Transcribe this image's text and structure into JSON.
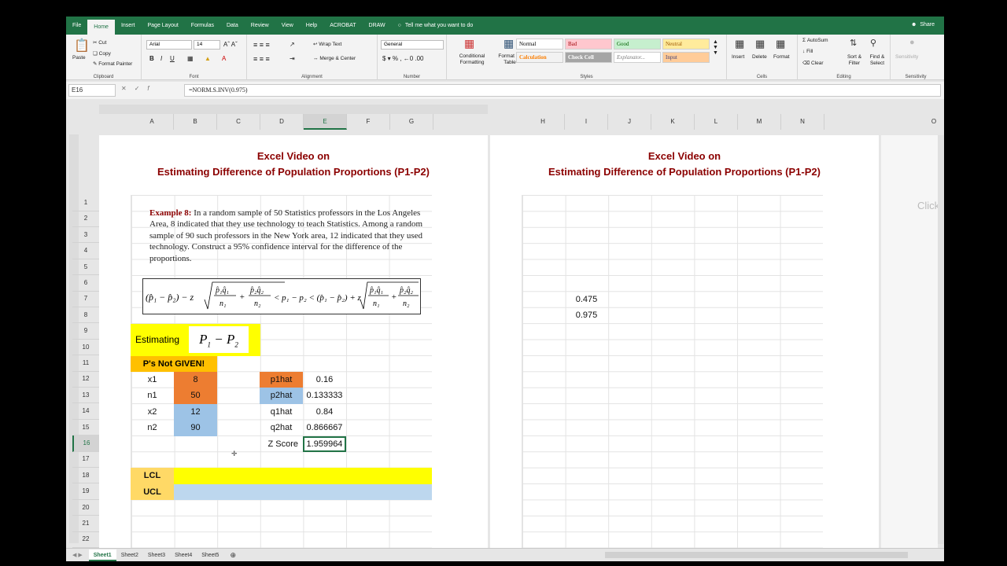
{
  "tabs": [
    "File",
    "Home",
    "Insert",
    "Page Layout",
    "Formulas",
    "Data",
    "Review",
    "View",
    "Help",
    "ACROBAT",
    "DRAW"
  ],
  "active_tab": "Home",
  "tell_me": "Tell me what you want to do",
  "share": "Share",
  "clipboard": {
    "paste": "Paste",
    "cut": "Cut",
    "copy": "Copy",
    "format_painter": "Format Painter",
    "label": "Clipboard"
  },
  "font": {
    "name": "Arial",
    "size": "14",
    "label": "Font"
  },
  "alignment": {
    "wrap": "Wrap Text",
    "merge": "Merge & Center",
    "label": "Alignment"
  },
  "number": {
    "format": "General",
    "label": "Number"
  },
  "styles": {
    "cond": "Conditional Formatting",
    "table": "Format as Table",
    "normal": "Normal",
    "bad": "Bad",
    "good": "Good",
    "neutral": "Neutral",
    "calculation": "Calculation",
    "check": "Check Cell",
    "explanatory": "Explanator...",
    "input": "Input",
    "label": "Styles"
  },
  "cells": {
    "insert": "Insert",
    "delete": "Delete",
    "format": "Format",
    "label": "Cells"
  },
  "editing": {
    "autosum": "AutoSum",
    "fill": "Fill",
    "clear": "Clear",
    "sort": "Sort & Filter",
    "find": "Find & Select",
    "label": "Editing"
  },
  "sensitivity": {
    "btn": "Sensitivity",
    "label": "Sensitivity"
  },
  "namebox": "E16",
  "formula": "=NORM.S.INV(0.975)",
  "columns": [
    "A",
    "B",
    "C",
    "D",
    "E",
    "F",
    "G",
    "H",
    "I",
    "J",
    "K",
    "L",
    "M",
    "N",
    "O"
  ],
  "rows": [
    "1",
    "2",
    "3",
    "4",
    "5",
    "6",
    "7",
    "8",
    "9",
    "10",
    "11",
    "12",
    "13",
    "14",
    "15",
    "16",
    "17",
    "18",
    "19",
    "20",
    "21",
    "22"
  ],
  "title1": "Excel Video on",
  "title2": "Estimating Difference of Population Proportions (P1-P2)",
  "example_label": "Example 8:",
  "example_text": "In a random sample of 50 Statistics professors in the Los Angeles Area, 8 indicated that they use technology to teach Statistics. Among a random sample of 90 such professors in the New York area, 12 indicated that they used technology. Construct a 95% confidence interval for the difference of the proportions.",
  "estimating": "Estimating",
  "p_not_given": "P's Not GIVEN!",
  "inputs": [
    {
      "label": "x1",
      "value": "8"
    },
    {
      "label": "n1",
      "value": "50"
    },
    {
      "label": "x2",
      "value": "12"
    },
    {
      "label": "n2",
      "value": "90"
    }
  ],
  "calc": [
    {
      "label": "p1hat",
      "value": "0.16"
    },
    {
      "label": "p2hat",
      "value": "0.133333"
    },
    {
      "label": "q1hat",
      "value": "0.84"
    },
    {
      "label": "q2hat",
      "value": "0.866667"
    },
    {
      "label": "Z Score",
      "value": "1.959964"
    }
  ],
  "lcl": "LCL",
  "ucl": "UCL",
  "page2_vals": [
    "0.475",
    "0.975"
  ],
  "click": "Click",
  "sheets": [
    "Sheet1",
    "Sheet2",
    "Sheet3",
    "Sheet4",
    "Sheet5"
  ]
}
